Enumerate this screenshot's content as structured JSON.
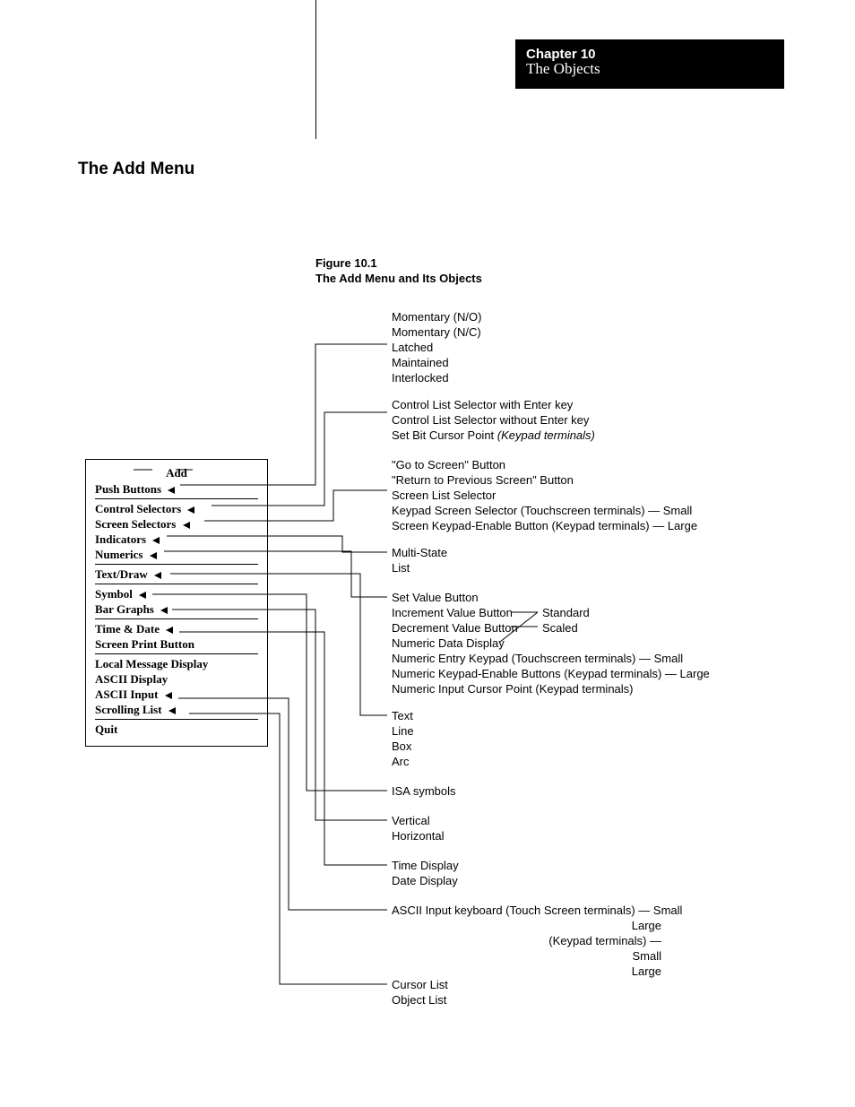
{
  "header": {
    "chapter": "Chapter  10",
    "title": "The Objects"
  },
  "section_heading": "The Add Menu",
  "figure": {
    "number": "Figure 10.1",
    "title": "The Add Menu and Its Objects"
  },
  "menu": {
    "title": "Add",
    "items": [
      {
        "label": "Push Buttons",
        "arrow": true,
        "hr_after": true
      },
      {
        "label": "Control Selectors",
        "arrow": true
      },
      {
        "label": "Screen Selectors",
        "arrow": true
      },
      {
        "label": "Indicators",
        "arrow": true
      },
      {
        "label": "Numerics",
        "arrow": true,
        "hr_after": true
      },
      {
        "label": "Text/Draw",
        "arrow": true,
        "hr_after": true
      },
      {
        "label": "Symbol",
        "arrow": true
      },
      {
        "label": "Bar Graphs",
        "arrow": true,
        "hr_after": true
      },
      {
        "label": "Time & Date",
        "arrow": true
      },
      {
        "label": "Screen Print Button",
        "arrow": false,
        "hr_after": true
      },
      {
        "label": "Local Message Display",
        "arrow": false
      },
      {
        "label": "ASCII Display",
        "arrow": false
      },
      {
        "label": "ASCII Input",
        "arrow": true
      },
      {
        "label": "Scrolling List",
        "arrow": true,
        "hr_after": true
      },
      {
        "label": "Quit",
        "arrow": false
      }
    ]
  },
  "groups": {
    "push_buttons": [
      "Momentary (N/O)",
      "Momentary (N/C)",
      "Latched",
      "Maintained",
      "Interlocked"
    ],
    "control_selectors": {
      "l1": "Control List Selector with Enter key",
      "l2": "Control List Selector without Enter key",
      "l3a": "Set Bit Cursor Point ",
      "l3b": "(Keypad terminals)"
    },
    "screen_selectors": [
      "\"Go to Screen\" Button",
      "\"Return to Previous Screen\" Button",
      "Screen List Selector",
      "Keypad Screen Selector (Touchscreen terminals) — Small",
      "Screen Keypad-Enable Button (Keypad terminals) — Large"
    ],
    "indicators": [
      "Multi-State",
      "List"
    ],
    "numerics": {
      "l1": "Set Value Button",
      "l2": "Increment Value Button",
      "l3": "Decrement Value Button",
      "l4": "Numeric Data Display",
      "l5": "Numeric Entry Keypad (Touchscreen terminals) — Small",
      "l6": "Numeric Keypad-Enable Buttons (Keypad terminals) — Large",
      "l7": "Numeric Input Cursor Point (Keypad terminals)",
      "side_a": "Standard",
      "side_b": "Scaled"
    },
    "text_draw": [
      "Text",
      "Line",
      "Box",
      "Arc"
    ],
    "symbol": [
      "ISA symbols"
    ],
    "bar_graphs": [
      "Vertical",
      "Horizontal"
    ],
    "time_date": [
      "Time Display",
      "Date Display"
    ],
    "ascii_input": {
      "l1": "ASCII Input keyboard (Touch Screen terminals) — Small",
      "l2": "Large",
      "l3": "(Keypad terminals) — Small",
      "l4": "Large"
    },
    "scrolling_list": [
      "Cursor List",
      "Object List"
    ]
  }
}
